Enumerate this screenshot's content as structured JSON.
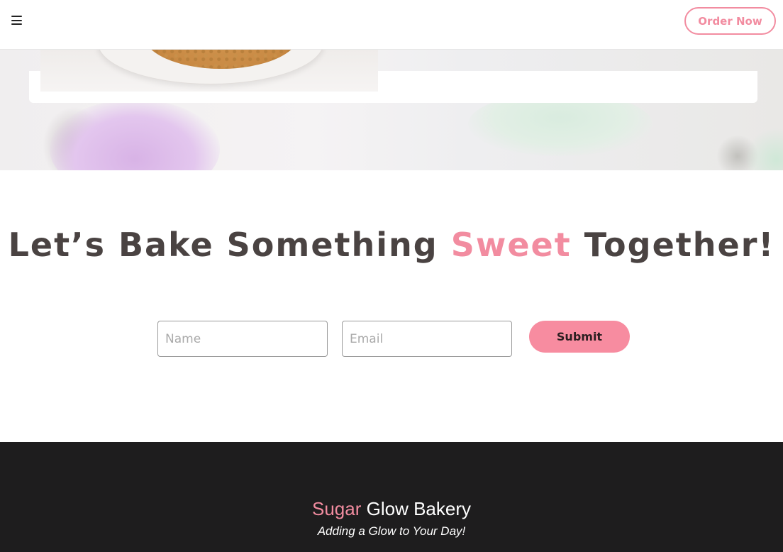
{
  "header": {
    "menu_icon": "hamburger-menu-icon",
    "order_button": "Order Now"
  },
  "contact": {
    "heading_before": "Let’s Bake Something",
    "heading_accent": "Sweet",
    "heading_after": "Together!",
    "name_placeholder": "Name",
    "email_placeholder": "Email",
    "submit_label": "Submit"
  },
  "footer": {
    "brand_accent": "Sugar",
    "brand_rest": "Glow Bakery",
    "tagline": "Adding a Glow to Your Day!"
  },
  "colors": {
    "accent": "#f28ca0",
    "footer_bg": "#1e1d1e",
    "heading": "#4a4342"
  }
}
